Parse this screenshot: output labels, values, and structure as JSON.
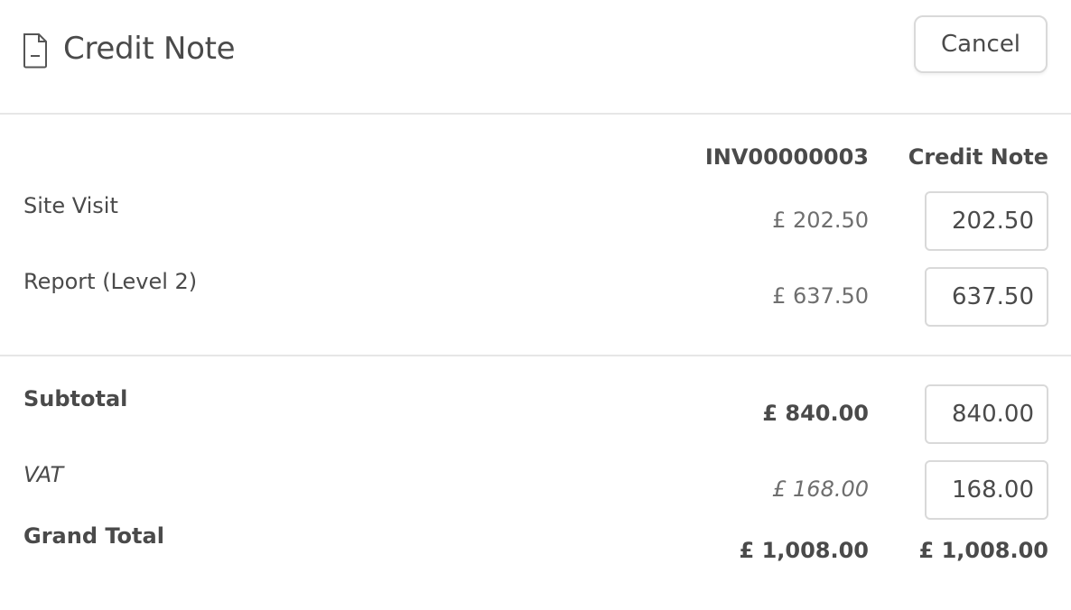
{
  "header": {
    "icon": "document-icon",
    "title": "Credit Note",
    "cancel_label": "Cancel"
  },
  "columns": {
    "invoice": "INV00000003",
    "credit": "Credit Note"
  },
  "lines": [
    {
      "label": "Site Visit",
      "invoice_amount": "£ 202.50",
      "credit_value": "202.50"
    },
    {
      "label": "Report (Level 2)",
      "invoice_amount": "£ 637.50",
      "credit_value": "637.50"
    }
  ],
  "totals": {
    "subtotal": {
      "label": "Subtotal",
      "invoice_amount": "£ 840.00",
      "credit_value": "840.00"
    },
    "vat": {
      "label": "VAT",
      "invoice_amount": "£ 168.00",
      "credit_value": "168.00"
    },
    "grand_total": {
      "label": "Grand Total",
      "invoice_amount": "£ 1,008.00",
      "credit_amount": "£ 1,008.00"
    }
  }
}
